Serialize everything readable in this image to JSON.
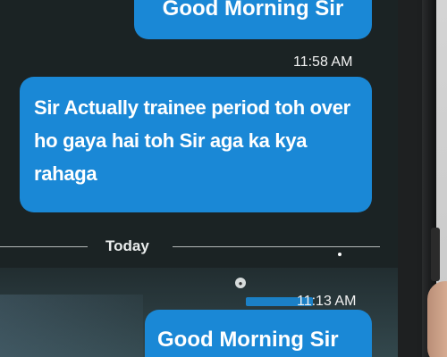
{
  "chat": {
    "messages": [
      {
        "text": "Good Morning Sir",
        "time": "11:58 AM"
      },
      {
        "text": "Sir Actually trainee period toh over ho gaya hai toh Sir aga ka kya rahaga"
      },
      {
        "text": "Good Morning Sir",
        "time": "11:13 AM"
      }
    ],
    "divider_label": "Today"
  },
  "colors": {
    "bubble": "#1a88d6",
    "screen_background": "#1b2324",
    "text": "#ffffff"
  },
  "icons": {
    "lock": "lock-icon"
  }
}
